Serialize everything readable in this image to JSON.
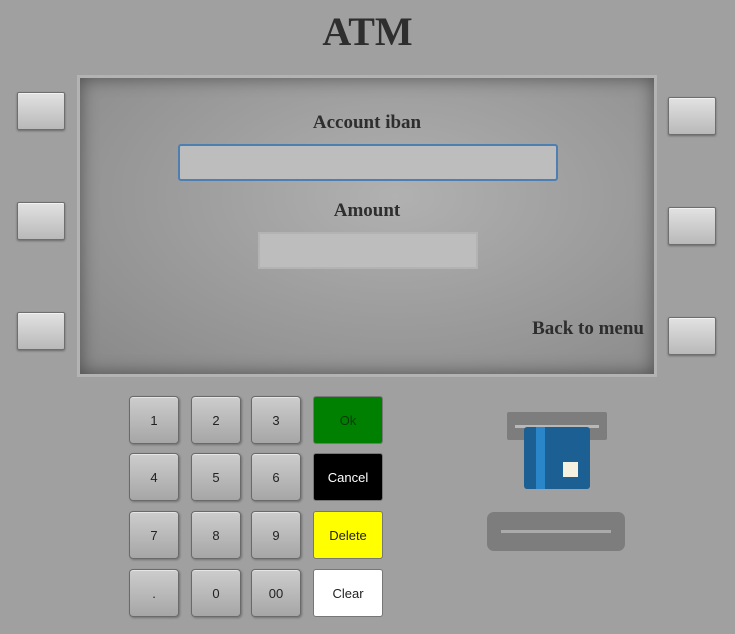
{
  "title": "ATM",
  "screen": {
    "account_label": "Account iban",
    "account_value": "",
    "amount_label": "Amount",
    "amount_value": "",
    "back_label": "Back to menu"
  },
  "keypad": {
    "digits": [
      "1",
      "2",
      "3",
      "4",
      "5",
      "6",
      "7",
      "8",
      "9",
      ".",
      "0",
      "00"
    ],
    "ok": "Ok",
    "cancel": "Cancel",
    "delete": "Delete",
    "clear": "Clear"
  },
  "colors": {
    "ok": "#008000",
    "cancel": "#000000",
    "delete": "#ffff00",
    "clear": "#ffffff",
    "card_primary": "#1b5f93",
    "card_stripe": "#2a86c9"
  },
  "icons": {
    "card_slot": "card-slot-icon",
    "card": "credit-card-icon",
    "cash_dispenser": "cash-dispenser-icon"
  }
}
